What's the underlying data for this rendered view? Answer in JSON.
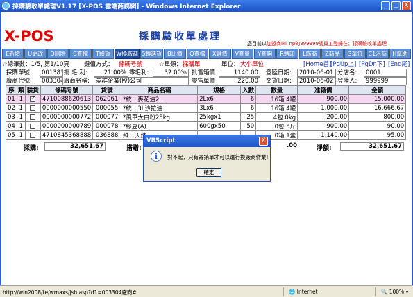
{
  "window": {
    "title": "採購驗收單處理V1.17 [X-POS 雲端商務網] - Windows Internet Explorer",
    "minimize": "_",
    "maximize": "□",
    "close": "X"
  },
  "header": {
    "logo": "X-POS",
    "page_title": "採購驗收單處理",
    "user_msg_prefix": "您目前以",
    "user_msg_login": "加盟商ikl_np的999999號員工登錄在",
    "user_msg_suffix": "採購驗收單處理"
  },
  "toolbar": {
    "buttons": [
      "E新增",
      "U更改",
      "D刪除",
      "C查檔",
      "T驗貨",
      "W換廠商",
      "S轉進貨",
      "B比價",
      "Q查檔",
      "X鍵值",
      "V查量",
      "Y查詢",
      "R轉印",
      "L廠商",
      "Z商品",
      "G單位",
      "C1治商",
      "H幫助"
    ],
    "active_index": 5
  },
  "info": {
    "total_records": "☆總筆數：1/5, 第1/10頁",
    "key_method_label": "鍵值方式：",
    "key_method_value": "條碼号號",
    "unit_type": "☆單類：",
    "unit_type_value": "採購單",
    "unit_label": "單位：",
    "unit_value": "大小單位",
    "nav_home": "[Home首]",
    "nav_pgup": "[PgUp上]",
    "nav_pgdn": "[PgDn下]",
    "nav_end": "[End尾]"
  },
  "form": {
    "purchase_no_label": "採購單號:",
    "purchase_no": "001383",
    "gross_profit_label": "批 毛 利:",
    "gross_profit": "21.00%",
    "retail_profit_label": "零毛利:",
    "retail_profit": "32.00%",
    "wholesale_price_label": "批售箱價",
    "wholesale_price": "1140.00",
    "register_date_label": "登陸日期:",
    "register_date": "2010-06-01",
    "branch_no_label": "分店名:",
    "branch_no": "0001",
    "vendor_code_label": "廠商代號:",
    "vendor_code": "003304",
    "vendor_name_label": "廠商名稱:",
    "vendor_name": "菱群企業(股)公司",
    "retail_price_label": "零售單價",
    "retail_price": "220.00",
    "trade_date_label": "交貨日期:",
    "trade_date": "2010-06-02",
    "entry_person_label": "登陸人:",
    "entry_person": "999999"
  },
  "table": {
    "headers": [
      "序",
      "類",
      "驗貨",
      "條碼号號",
      "貨號",
      "商品名稱",
      "規格",
      "入數",
      "數量",
      "進箱價",
      "金額"
    ],
    "rows": [
      {
        "seq": "01",
        "type": "1",
        "checked": true,
        "barcode": "4710088620613",
        "item_no": "062061",
        "name": "*統一麥花油2L",
        "spec": "2Lx6",
        "qty_in": "6",
        "count": "16箱 4罐",
        "price": "900.00",
        "amount": "15,000.00",
        "selected": true
      },
      {
        "seq": "02",
        "type": "1",
        "checked": false,
        "barcode": "0000000000550",
        "item_no": "000055",
        "name": "*統一3L沙拉油",
        "spec": "3Lx6",
        "qty_in": "6",
        "count": "16箱 4罐",
        "price": "1,000.00",
        "amount": "16,666.67",
        "selected": false
      },
      {
        "seq": "03",
        "type": "1",
        "checked": false,
        "barcode": "0000000000772",
        "item_no": "000077",
        "name": "*風車太白粉25kg",
        "spec": "25kgx1",
        "qty_in": "25",
        "count": "4包 0kg",
        "price": "200.00",
        "amount": "800.00",
        "selected": false
      },
      {
        "seq": "04",
        "type": "1",
        "checked": false,
        "barcode": "0000000000789",
        "item_no": "000078",
        "name": "*綠豆(A)",
        "spec": "600gx50",
        "qty_in": "50",
        "count": "0包 5斤",
        "price": "900.00",
        "amount": "90.00",
        "selected": false
      },
      {
        "seq": "05",
        "type": "1",
        "checked": false,
        "barcode": "4710845368888",
        "item_no": "036888",
        "name": "維一天然...",
        "spec": "",
        "qty_in": "",
        "count": "0箱 1盒",
        "price": "1,140.00",
        "amount": "95.00",
        "selected": false
      }
    ]
  },
  "totals": {
    "purchase_label": "採購:",
    "purchase_value": "32,651.67",
    "discount_label": "搭贈:",
    "discount_value": ".00",
    "net_label": "淨額:",
    "net_value": "32,651.67"
  },
  "dialog": {
    "title": "VBScript",
    "icon": "i",
    "message": "對不起，只有寄銷單才可以進行換廠商作業!",
    "ok": "確定",
    "close": "X"
  },
  "statusbar": {
    "url": "http://win2008/te/wmaxs/jsh.asp?d1=003304廠商#",
    "zone": "Internet",
    "zoom": "100%"
  }
}
